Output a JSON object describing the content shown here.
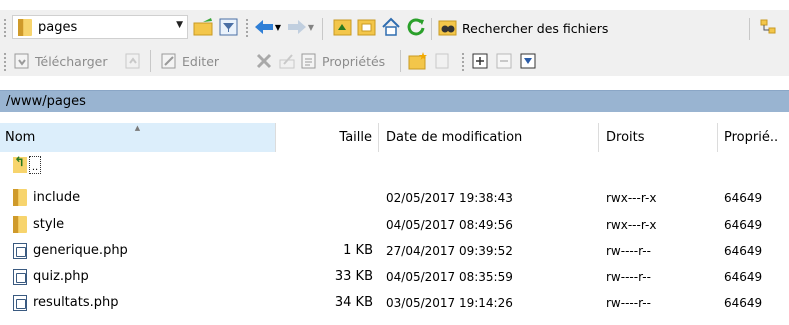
{
  "toolbar1": {
    "path_value": "pages",
    "search_label": "Rechercher des fichiers"
  },
  "toolbar2": {
    "download_label": "Télécharger",
    "edit_label": "Editer",
    "properties_label": "Propriétés"
  },
  "path_bar": {
    "path": "/www/pages"
  },
  "table": {
    "columns": {
      "name": "Nom",
      "size": "Taille",
      "modified": "Date de modification",
      "rights": "Droits",
      "owner": "Proprié.."
    },
    "parent_label": "..",
    "rows": [
      {
        "name": "include",
        "type": "folder",
        "size": "",
        "modified": "02/05/2017 19:38:43",
        "rights": "rwx---r-x",
        "owner": "64649"
      },
      {
        "name": "style",
        "type": "folder",
        "size": "",
        "modified": "04/05/2017 08:49:56",
        "rights": "rwx---r-x",
        "owner": "64649"
      },
      {
        "name": "generique.php",
        "type": "file",
        "size": "1 KB",
        "modified": "27/04/2017 09:39:52",
        "rights": "rw----r--",
        "owner": "64649"
      },
      {
        "name": "quiz.php",
        "type": "file",
        "size": "33 KB",
        "modified": "04/05/2017 08:35:59",
        "rights": "rw----r--",
        "owner": "64649"
      },
      {
        "name": "resultats.php",
        "type": "file",
        "size": "34 KB",
        "modified": "03/05/2017 19:14:26",
        "rights": "rw----r--",
        "owner": "64649"
      }
    ]
  },
  "colors": {
    "path_bar": "#99b4d1",
    "sorted_header": "#dceefb",
    "folder": "#f7d46d",
    "nav_blue": "#2f7fd6",
    "refresh_green": "#2aa02a"
  }
}
